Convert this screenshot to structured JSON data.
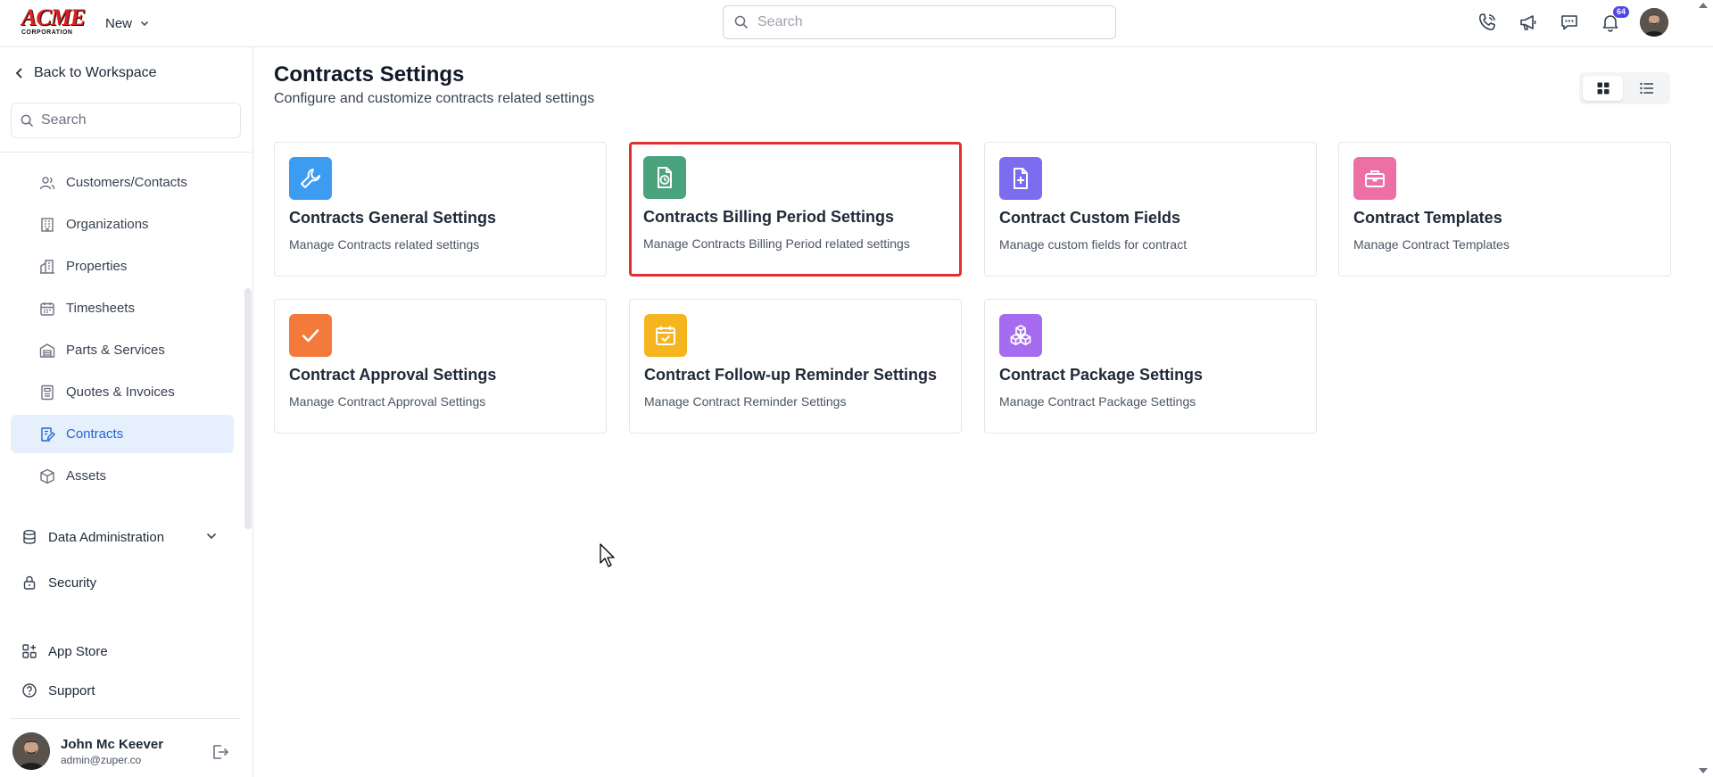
{
  "topbar": {
    "logo_main": "ACME",
    "logo_sub": "CORPORATION",
    "new_label": "New",
    "search_placeholder": "Search",
    "notification_count": "64"
  },
  "sidebar": {
    "back_label": "Back to Workspace",
    "search_placeholder": "Search",
    "sub_items": [
      {
        "label": "Customers/Contacts",
        "icon": "contacts-icon"
      },
      {
        "label": "Organizations",
        "icon": "building-icon"
      },
      {
        "label": "Properties",
        "icon": "property-icon"
      },
      {
        "label": "Timesheets",
        "icon": "calendar-icon"
      },
      {
        "label": "Parts & Services",
        "icon": "warehouse-icon"
      },
      {
        "label": "Quotes & Invoices",
        "icon": "invoice-icon"
      },
      {
        "label": "Contracts",
        "icon": "contract-icon",
        "active": true
      },
      {
        "label": "Assets",
        "icon": "cube-icon"
      }
    ],
    "data_admin_label": "Data Administration",
    "security_label": "Security",
    "app_store_label": "App Store",
    "support_label": "Support",
    "user": {
      "name": "John Mc Keever",
      "email": "admin@zuper.co"
    }
  },
  "main": {
    "title": "Contracts Settings",
    "subtitle": "Configure and customize contracts related settings",
    "cards": [
      {
        "title": "Contracts General Settings",
        "desc": "Manage Contracts related settings",
        "icon": "wrench-icon",
        "color": "#3b9cf2"
      },
      {
        "title": "Contracts Billing Period Settings",
        "desc": "Manage Contracts Billing Period related settings",
        "icon": "document-clock-icon",
        "color": "#4aa37d",
        "selected": true
      },
      {
        "title": "Contract Custom Fields",
        "desc": "Manage custom fields for contract",
        "icon": "document-plus-icon",
        "color": "#7b6cf0"
      },
      {
        "title": "Contract Templates",
        "desc": "Manage Contract Templates",
        "icon": "briefcase-icon",
        "color": "#ec6fa6"
      },
      {
        "title": "Contract Approval Settings",
        "desc": "Manage Contract Approval Settings",
        "icon": "check-icon",
        "color": "#f47a3b"
      },
      {
        "title": "Contract Follow-up Reminder Settings",
        "desc": "Manage Contract Reminder Settings",
        "icon": "calendar-check-icon",
        "color": "#f5b51f"
      },
      {
        "title": "Contract Package Settings",
        "desc": "Manage Contract Package Settings",
        "icon": "boxes-icon",
        "color": "#a56cf0"
      }
    ]
  },
  "colors": {
    "accent": "#1e66d0",
    "active_bg": "#e6effc",
    "highlight": "#e03131",
    "badge": "#4f46e5"
  }
}
